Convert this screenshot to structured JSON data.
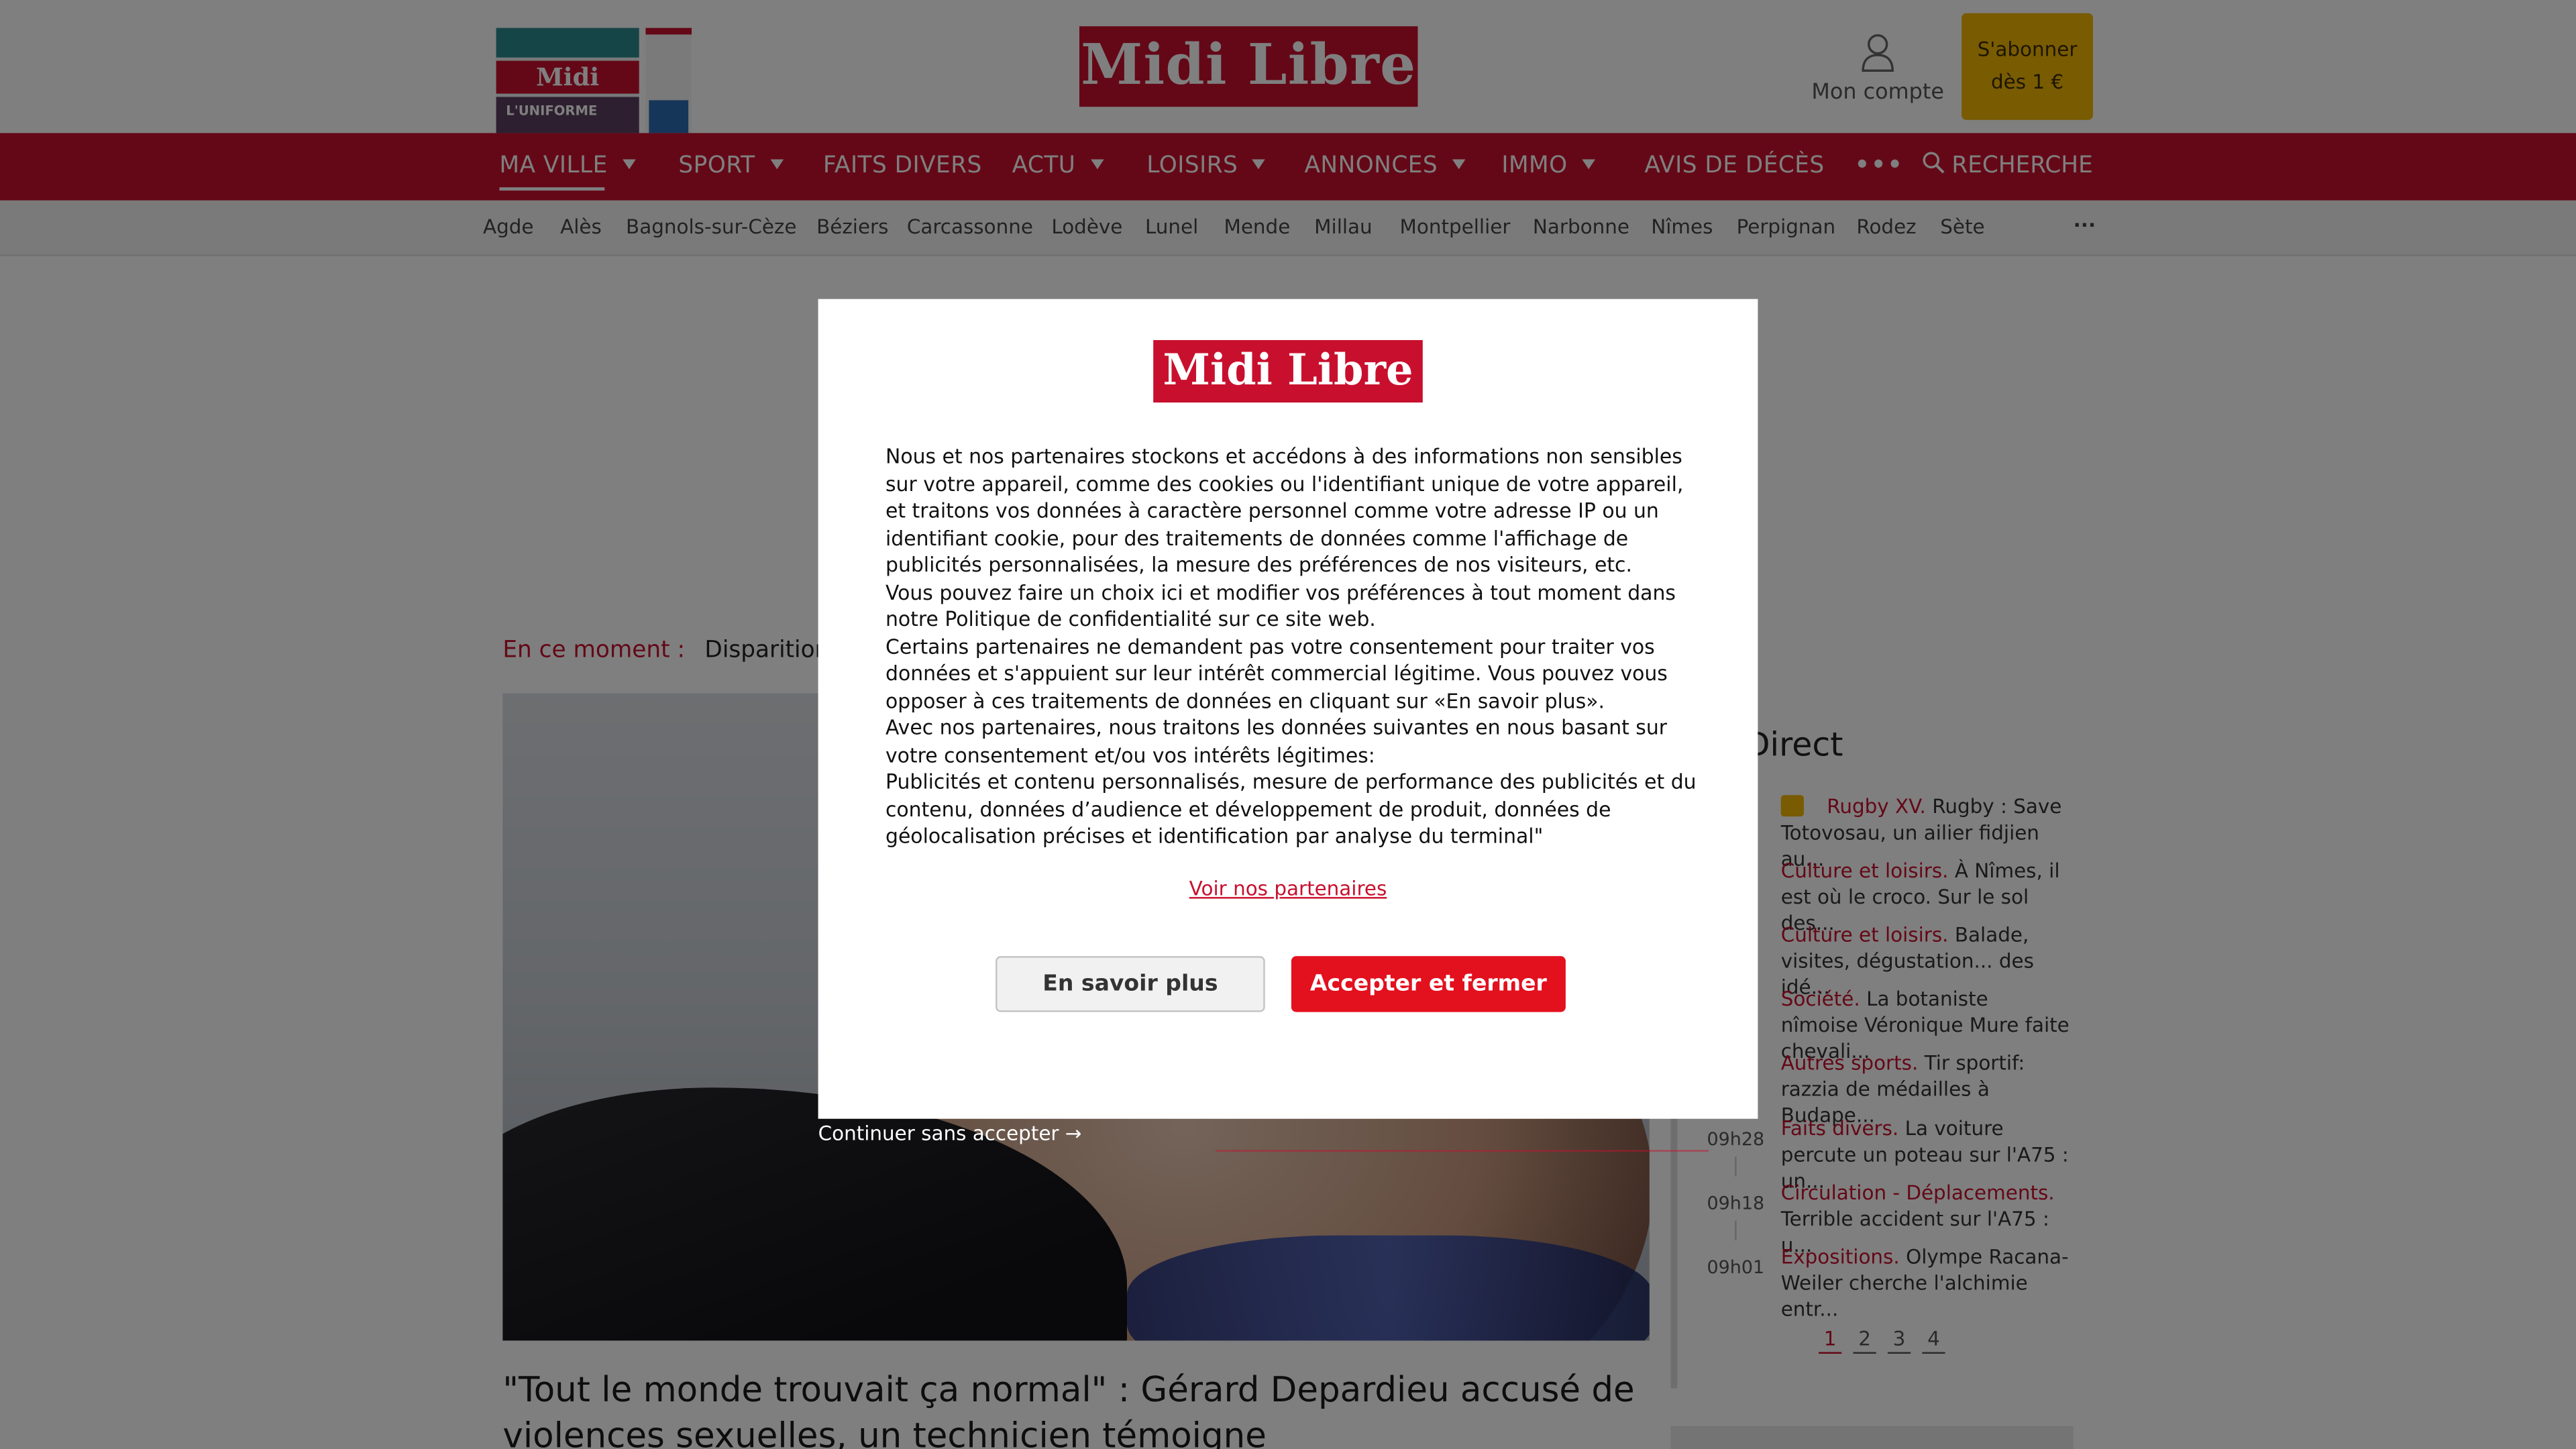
{
  "header": {
    "brand": "Midi Libre",
    "cover_logo": "Midi Libre",
    "cover_headline": "L'UNIFORME",
    "account_label": "Mon compte",
    "subscribe_line1": "S'abonner",
    "subscribe_line2": "dès 1 €"
  },
  "nav": {
    "items": [
      {
        "label": "MA VILLE",
        "dropdown": true
      },
      {
        "label": "SPORT",
        "dropdown": true
      },
      {
        "label": "FAITS DIVERS",
        "dropdown": false
      },
      {
        "label": "ACTU",
        "dropdown": true
      },
      {
        "label": "LOISIRS",
        "dropdown": true
      },
      {
        "label": "ANNONCES",
        "dropdown": true
      },
      {
        "label": "IMMO",
        "dropdown": true
      },
      {
        "label": "AVIS DE DÉCÈS",
        "dropdown": false
      }
    ],
    "more": "•••",
    "search_label": "RECHERCHE"
  },
  "cities": [
    "Agde",
    "Alès",
    "Bagnols-sur-Cèze",
    "Béziers",
    "Carcassonne",
    "Lodève",
    "Lunel",
    "Mende",
    "Millau",
    "Montpellier",
    "Narbonne",
    "Nîmes",
    "Perpignan",
    "Rodez",
    "Sète"
  ],
  "cities_more": "···",
  "trending": {
    "label": "En ce moment :",
    "text": "Disparition d"
  },
  "article": {
    "headline": "\"Tout le monde trouvait ça normal\" : Gérard Depardieu accusé de violences sexuelles, un technicien témoigne"
  },
  "live": {
    "title": "Direct",
    "items": [
      {
        "time": "",
        "category": "Rugby XV.",
        "text": "Rugby : Save Totovosau, un ailier fidjien au...",
        "premium": true
      },
      {
        "time": "",
        "category": "Culture et loisirs.",
        "text": "À Nîmes, il est où le croco. Sur le sol des...",
        "premium": false
      },
      {
        "time": "",
        "category": "Culture et loisirs.",
        "text": "Balade, visites, dégustation... des idé...",
        "premium": false
      },
      {
        "time": "",
        "category": "Société.",
        "text": "La botaniste nîmoise Véronique Mure faite chevali...",
        "premium": false
      },
      {
        "time": "",
        "category": "Autres sports.",
        "text": "Tir sportif: razzia de médailles à Budape...",
        "premium": false
      },
      {
        "time": "09h28",
        "category": "Faits divers.",
        "text": "La voiture percute un poteau sur l'A75 : un...",
        "premium": false
      },
      {
        "time": "09h18",
        "category": "Circulation - Déplacements.",
        "text": "Terrible accident sur l'A75 : u...",
        "premium": false
      },
      {
        "time": "09h01",
        "category": "Expositions.",
        "text": "Olympe Racana-Weiler cherche l'alchimie entr...",
        "premium": false
      }
    ],
    "pages": [
      "1",
      "2",
      "3",
      "4"
    ],
    "current_page": "1"
  },
  "consent": {
    "logo": "Midi Libre",
    "paragraphs": [
      "Nous et nos partenaires stockons et accédons à des informations non sensibles sur votre appareil, comme des cookies ou l'identifiant unique de votre appareil, et traitons vos données à caractère personnel comme votre adresse IP ou un identifiant cookie, pour des traitements de données comme l'affichage de publicités personnalisées, la mesure des préférences de nos visiteurs, etc.",
      "Vous pouvez faire un choix ici et modifier vos préférences à tout moment dans notre Politique de confidentialité sur ce site web.",
      "Certains partenaires ne demandent pas votre consentement pour traiter vos données et s'appuient sur leur intérêt commercial légitime. Vous pouvez vous opposer à ces traitements de données en cliquant sur «En savoir plus».",
      "Avec nos partenaires, nous traitons les données suivantes en nous basant sur votre consentement et/ou vos intérêts légitimes:",
      "Publicités et contenu personnalisés, mesure de performance des publicités et du contenu, données d’audience et développement de produit, données de géolocalisation précises et identification par analyse du terminal\""
    ],
    "partners_link": "Voir nos partenaires",
    "learn_more": "En savoir plus",
    "accept": "Accepter et fermer",
    "continue": "Continuer sans accepter →"
  },
  "colors": {
    "brand_red": "#c8102e",
    "accept_red": "#e3101e",
    "subscribe_yellow": "#f2b705"
  }
}
